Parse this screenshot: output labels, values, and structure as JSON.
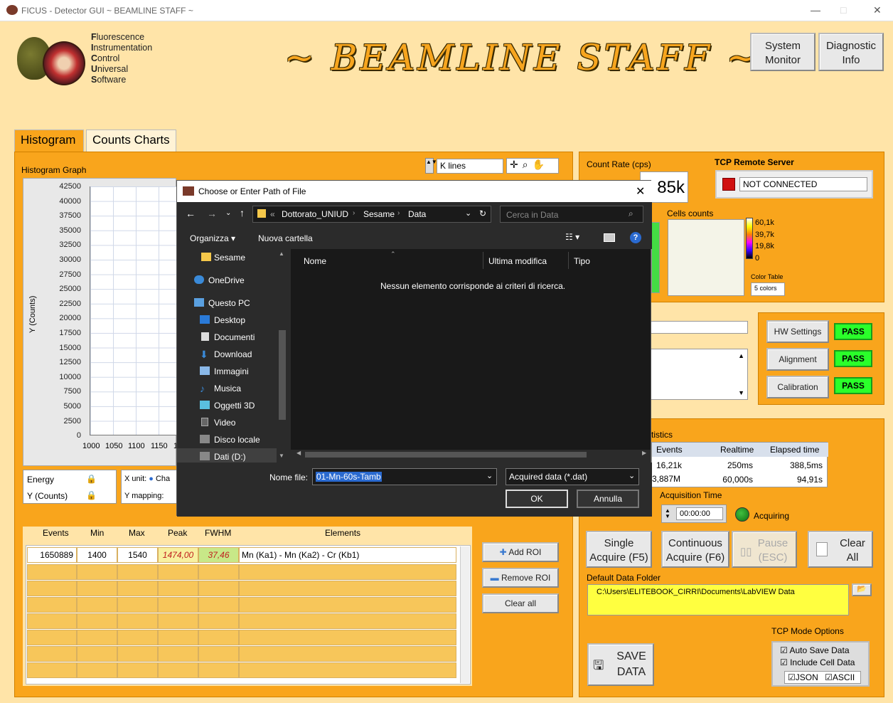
{
  "window": {
    "title": "FICUS - Detector GUI ~ BEAMLINE STAFF ~"
  },
  "logo": {
    "lines": [
      [
        "F",
        "luorescence"
      ],
      [
        "I",
        "nstrumentation"
      ],
      [
        "C",
        "ontrol"
      ],
      [
        "U",
        "niversal"
      ],
      [
        "S",
        "oftware"
      ]
    ]
  },
  "banner": "~ BEAMLINE STAFF ~",
  "header_buttons": {
    "system_monitor": "System Monitor",
    "diagnostic_info": "Diagnostic Info"
  },
  "tabs": {
    "histogram": "Histogram",
    "counts_charts": "Counts Charts"
  },
  "histogram": {
    "title": "Histogram Graph",
    "lines_field": "K lines",
    "y_axis_label": "Y (Counts)",
    "y_ticks": [
      "42500",
      "40000",
      "37500",
      "35000",
      "32500",
      "30000",
      "27500",
      "25000",
      "22500",
      "20000",
      "17500",
      "15000",
      "12500",
      "10000",
      "7500",
      "5000",
      "2500",
      "0"
    ],
    "x_ticks": [
      "1000",
      "1050",
      "1100",
      "1150",
      "1"
    ],
    "energy_label": "Energy",
    "ycounts_label": "Y (Counts)",
    "xunit_label": "X unit:",
    "xunit_value": "Cha",
    "ymapping_label": "Y mapping:"
  },
  "roi": {
    "headers": [
      "Events",
      "Min",
      "Max",
      "Peak",
      "FWHM",
      "Elements"
    ],
    "row": {
      "events": "1650889",
      "min": "1400",
      "max": "1540",
      "peak": "1474,00",
      "fwhm": "37,46",
      "elements": "Mn (Ka1) - Mn (Ka2) - Cr (Kb1)"
    },
    "add": "Add ROI",
    "remove": "Remove ROI",
    "clear": "Clear all"
  },
  "right": {
    "count_rate_label": "Count Rate (cps)",
    "count_rate_value": "85k",
    "tcp_label": "TCP Remote Server",
    "tcp_status": "NOT CONNECTED",
    "cells_label": "Cells counts",
    "scale": [
      "60,1k",
      "39,7k",
      "19,8k",
      "0"
    ],
    "color_table_label": "Color Table",
    "color_table_value": "5 colors",
    "hw_settings": "HW Settings",
    "alignment": "Alignment",
    "calibration": "Calibration",
    "pass": "PASS",
    "stats_label": "tistics",
    "stats_headers": [
      "Events",
      "Realtime",
      "Elapsed time"
    ],
    "stats_rows": [
      [
        "16,21k",
        "250ms",
        "388,5ms"
      ],
      [
        "3,887M",
        "60,000s",
        "94,91s"
      ]
    ],
    "acq_time_label": "Acquisition Time",
    "acq_time_value": "00:00:00",
    "acquiring": "Acquiring",
    "single": "Single Acquire (F5)",
    "continuous": "Continuous Acquire (F6)",
    "pause": "Pause (ESC)",
    "clear": "Clear All",
    "folder_label": "Default Data Folder",
    "folder_value": "C:\\Users\\ELITEBOOK_CIRRI\\Documents\\LabVIEW Data",
    "tcp_mode_label": "TCP Mode Options",
    "auto_save": "Auto Save Data",
    "include_cell": "Include Cell Data",
    "json": "JSON",
    "ascii": "ASCII",
    "save": "SAVE DATA",
    "acq_partial": "250 ms"
  },
  "dialog": {
    "title": "Choose or Enter Path of File",
    "crumbs": [
      "Dottorato_UNIUD",
      "Sesame",
      "Data"
    ],
    "search_placeholder": "Cerca in Data",
    "organizza": "Organizza",
    "nuova_cartella": "Nuova cartella",
    "sidebar": [
      "Sesame",
      "OneDrive",
      "Questo PC",
      "Desktop",
      "Documenti",
      "Download",
      "Immagini",
      "Musica",
      "Oggetti 3D",
      "Video",
      "Disco locale (C:)",
      "Dati (D:)"
    ],
    "cols": [
      "Nome",
      "Ultima modifica",
      "Tipo"
    ],
    "empty": "Nessun elemento corrisponde ai criteri di ricerca.",
    "filename_label": "Nome file:",
    "filename_value": "01-Mn-60s-Tamb",
    "filter": "Acquired data (*.dat)",
    "ok": "OK",
    "cancel": "Annulla"
  },
  "colors": {
    "orange": "#f9a51c",
    "bg": "#ffe4a8",
    "pass": "#2aff2a",
    "folder": "#ffff40"
  }
}
